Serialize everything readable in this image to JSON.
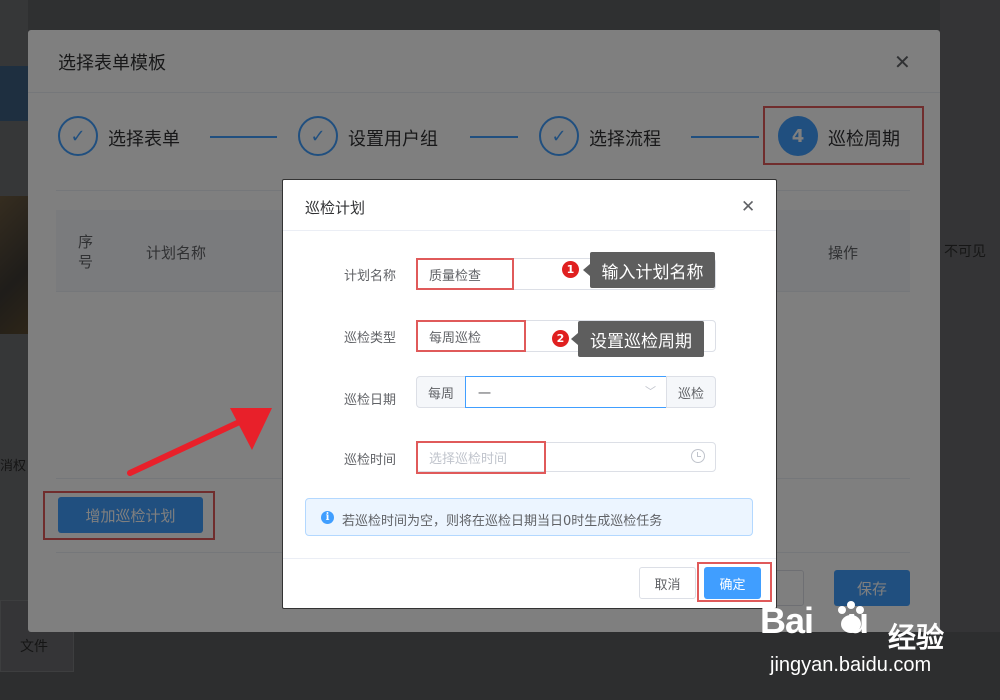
{
  "background": {
    "right_text": "不可见",
    "left_text": "消权",
    "file_label": "文件",
    "save_label": "保存"
  },
  "outer_dialog": {
    "title": "选择表单模板",
    "close_icon": "close-icon",
    "steps": [
      {
        "label": "选择表单",
        "state": "done",
        "icon": "check-icon"
      },
      {
        "label": "设置用户组",
        "state": "done",
        "icon": "check-icon"
      },
      {
        "label": "选择流程",
        "state": "done",
        "icon": "check-icon"
      },
      {
        "label": "巡检周期",
        "state": "active",
        "number": "4"
      }
    ],
    "table_headers": [
      "序号",
      "计划名称",
      "操作"
    ],
    "add_plan_button": "增加巡检计划"
  },
  "inner_dialog": {
    "title": "巡检计划",
    "fields": {
      "plan_name": {
        "label": "计划名称",
        "value": "质量检查"
      },
      "patrol_type": {
        "label": "巡检类型",
        "value": "每周巡检"
      },
      "patrol_date": {
        "label": "巡检日期",
        "prefix": "每周",
        "value": "一",
        "suffix": "巡检"
      },
      "patrol_time": {
        "label": "巡检时间",
        "placeholder": "选择巡检时间"
      }
    },
    "info_alert": "若巡检时间为空，则将在巡检日期当日0时生成巡检任务",
    "cancel_button": "取消",
    "confirm_button": "确定"
  },
  "annotations": {
    "tip1": {
      "badge": "1",
      "text": "输入计划名称"
    },
    "tip2": {
      "badge": "2",
      "text": "设置巡检周期"
    }
  },
  "watermark": {
    "logo": "Bai du",
    "brand": "经验",
    "url": "jingyan.baidu.com"
  },
  "colors": {
    "primary": "#409eff",
    "annotation_red": "#e05a5a",
    "badge_red": "#e02020",
    "tooltip_bg": "#5e5e5e"
  }
}
